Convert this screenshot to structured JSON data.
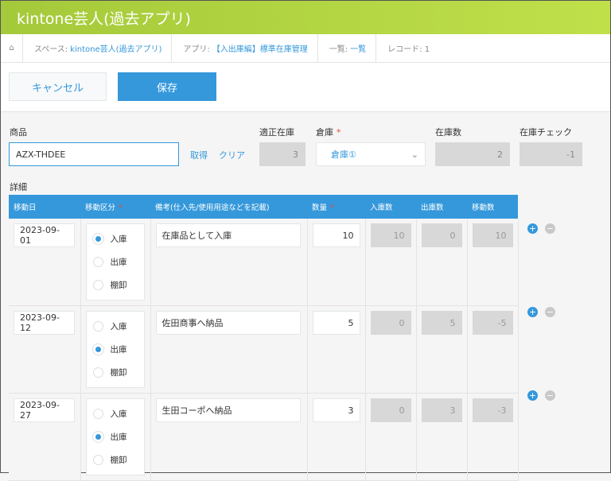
{
  "app_title": "kintone芸人(過去アプリ)",
  "breadcrumb": {
    "space_label": "スペース:",
    "space": "kintone芸人(過去アプリ)",
    "app_label": "アプリ:",
    "app": "【入出庫編】標準在庫管理",
    "view_label": "一覧:",
    "view": "一覧",
    "record": "レコード: 1"
  },
  "toolbar": {
    "cancel": "キャンセル",
    "save": "保存"
  },
  "form": {
    "product_label": "商品",
    "product_value": "AZX-THDEE",
    "get": "取得",
    "clear": "クリア",
    "proper_stock_label": "適正在庫",
    "proper_stock": "3",
    "warehouse_label": "倉庫",
    "warehouse": "倉庫①",
    "stock_label": "在庫数",
    "stock": "2",
    "check_label": "在庫チェック",
    "check": "-1",
    "detail_label": "詳細",
    "required_mark": "*"
  },
  "table": {
    "headers": [
      "移動日",
      "移動区分",
      "備考(仕入先/使用用途などを記載)",
      "数量",
      "入庫数",
      "出庫数",
      "移動数"
    ],
    "options": [
      "入庫",
      "出庫",
      "棚卸"
    ],
    "rows": [
      {
        "date": "2023-09-01",
        "kind": "入庫",
        "note": "在庫品として入庫",
        "qty": "10",
        "in": "10",
        "out": "0",
        "move": "10"
      },
      {
        "date": "2023-09-12",
        "kind": "出庫",
        "note": "佐田商事へ納品",
        "qty": "5",
        "in": "0",
        "out": "5",
        "move": "-5"
      },
      {
        "date": "2023-09-27",
        "kind": "出庫",
        "note": "生田コーポへ納品",
        "qty": "3",
        "in": "0",
        "out": "3",
        "move": "-3"
      }
    ]
  },
  "colors": {
    "accent": "#3498db",
    "title": "#a4c93a"
  }
}
